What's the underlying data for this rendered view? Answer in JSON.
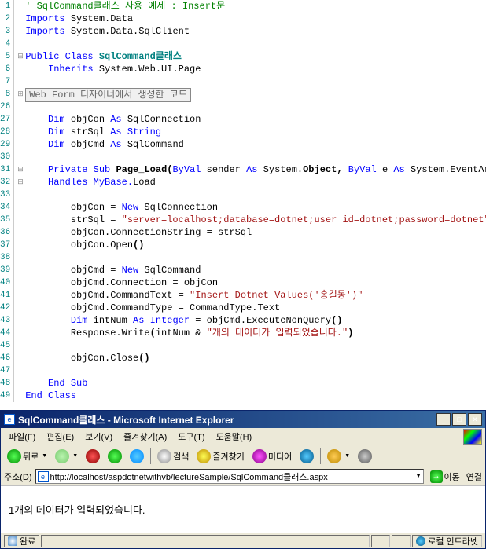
{
  "code": {
    "lines": [
      {
        "n": "1",
        "html": "<span class='c-comment'>' SqlCommand클래스 사용 예제 : Insert문</span>"
      },
      {
        "n": "2",
        "html": "<span class='c-keyword'>Imports</span> System.Data"
      },
      {
        "n": "3",
        "html": "<span class='c-keyword'>Imports</span> System.Data.SqlClient"
      },
      {
        "n": "4",
        "html": ""
      },
      {
        "n": "5",
        "html": "<span class='c-keyword'>Public</span> <span class='c-keyword'>Class</span> <span class='c-type'>SqlCommand클래스</span>",
        "marker": "⊟"
      },
      {
        "n": "6",
        "html": "    <span class='c-keyword'>Inherits</span> System.Web.UI.Page"
      },
      {
        "n": "7",
        "html": ""
      },
      {
        "n": "8",
        "html": "<span class='c-region'>Web Form 디자이너에서 생성한 코드</span>",
        "marker": "⊞"
      },
      {
        "n": "26",
        "html": ""
      },
      {
        "n": "27",
        "html": "    <span class='c-keyword'>Dim</span> objCon <span class='c-keyword'>As</span> SqlConnection"
      },
      {
        "n": "28",
        "html": "    <span class='c-keyword'>Dim</span> strSql <span class='c-keyword'>As</span> <span class='c-keyword'>String</span>"
      },
      {
        "n": "29",
        "html": "    <span class='c-keyword'>Dim</span> objCmd <span class='c-keyword'>As</span> SqlCommand"
      },
      {
        "n": "30",
        "html": ""
      },
      {
        "n": "31",
        "html": "    <span class='c-keyword'>Private</span> <span class='c-keyword'>Sub</span> <span class='c-method'>Page_Load(</span><span class='c-keyword'>ByVal</span> sender <span class='c-keyword'>As</span> System.<span class='c-method'>Object,</span> <span class='c-keyword'>ByVal</span> e <span class='c-keyword'>As</span> System.EventArgs<span class='c-method'>)</span> _",
        "marker": "⊟"
      },
      {
        "n": "32",
        "html": "    <span class='c-keyword'>Handles</span> <span class='c-keyword'>MyBase.</span>Load",
        "marker": "⊟"
      },
      {
        "n": "33",
        "html": ""
      },
      {
        "n": "34",
        "html": "        objCon = <span class='c-keyword'>New</span> SqlConnection"
      },
      {
        "n": "35",
        "html": "        strSql = <span class='c-string'>\"server=localhost;database=dotnet;user id=dotnet;password=dotnet\"</span>"
      },
      {
        "n": "36",
        "html": "        objCon.ConnectionString = strSql"
      },
      {
        "n": "37",
        "html": "        objCon.Open<span class='c-method'>()</span>"
      },
      {
        "n": "38",
        "html": ""
      },
      {
        "n": "39",
        "html": "        objCmd = <span class='c-keyword'>New</span> SqlCommand"
      },
      {
        "n": "40",
        "html": "        objCmd.Connection = objCon"
      },
      {
        "n": "41",
        "html": "        objCmd.CommandText = <span class='c-string'>\"Insert Dotnet Values('홍길동')\"</span>"
      },
      {
        "n": "42",
        "html": "        objCmd.CommandType = CommandType.Text"
      },
      {
        "n": "43",
        "html": "        <span class='c-keyword'>Dim</span> intNum <span class='c-keyword'>As</span> <span class='c-keyword'>Integer</span> = objCmd.ExecuteNonQuery<span class='c-method'>()</span>"
      },
      {
        "n": "44",
        "html": "        Response.Write<span class='c-method'>(</span>intNum &amp; <span class='c-string'>\"개의 데이터가 입력되었습니다.\"</span><span class='c-method'>)</span>"
      },
      {
        "n": "45",
        "html": ""
      },
      {
        "n": "46",
        "html": "        objCon.Close<span class='c-method'>()</span>"
      },
      {
        "n": "47",
        "html": ""
      },
      {
        "n": "48",
        "html": "    <span class='c-keyword'>End</span> <span class='c-keyword'>Sub</span>"
      },
      {
        "n": "49",
        "html": "<span class='c-keyword'>End</span> <span class='c-keyword'>Class</span>"
      }
    ]
  },
  "ie": {
    "title": "SqlCommand클래스 - Microsoft Internet Explorer",
    "menu": [
      "파일(F)",
      "편집(E)",
      "보기(V)",
      "즐겨찾기(A)",
      "도구(T)",
      "도움말(H)"
    ],
    "toolbar": {
      "back": "뒤로",
      "search": "검색",
      "favorites": "즐겨찾기",
      "media": "미디어"
    },
    "address_label": "주소(D)",
    "url": "http://localhost/aspdotnetwithvb/lectureSample/SqlCommand클래스.aspx",
    "go": "이동",
    "links": "연결",
    "content": "1개의 데이터가 입력되었습니다.",
    "status_left": "완료",
    "status_right": "로컬 인트라넷"
  }
}
